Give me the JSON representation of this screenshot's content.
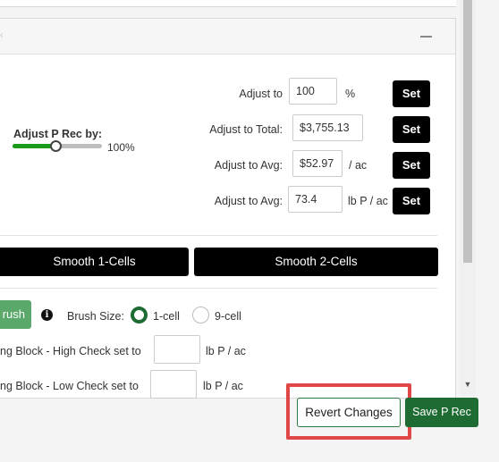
{
  "adjust_slider": {
    "label": "Adjust P Rec by:",
    "value_text": "100%",
    "value_fraction": 0.49
  },
  "adjust_rows": [
    {
      "label": "Adjust to",
      "value": "100",
      "unit": "%",
      "button": "Set"
    },
    {
      "label": "Adjust to Total:",
      "value": "$3,755.13",
      "unit": "",
      "button": "Set"
    },
    {
      "label": "Adjust to Avg:",
      "value": "$52.97",
      "unit": "/ ac",
      "button": "Set"
    },
    {
      "label": "Adjust to Avg:",
      "value": "73.4",
      "unit": "lb P / ac",
      "button": "Set"
    }
  ],
  "smooth": {
    "one_cell": "Smooth 1-Cells",
    "two_cell": "Smooth 2-Cells"
  },
  "brush": {
    "button": "rush",
    "size_label": "Brush Size:",
    "options": [
      "1-cell",
      "9-cell"
    ],
    "selected": "1-cell"
  },
  "blocks": [
    {
      "label": "ng Block - High Check  set to",
      "value": "",
      "unit": "lb P / ac"
    },
    {
      "label": "ng Block - Low Check  set to",
      "value": "",
      "unit": "lb P / ac"
    }
  ],
  "footer": {
    "revert": "Revert Changes",
    "save": "Save P Rec"
  },
  "colors": {
    "accent_green": "#1e6b34",
    "slider_green": "#1a9a1a",
    "highlight_red": "#e04848"
  },
  "icons": {
    "collapse": "minus-icon",
    "info": "info-icon",
    "scroll_down": "triangle-down-icon"
  }
}
